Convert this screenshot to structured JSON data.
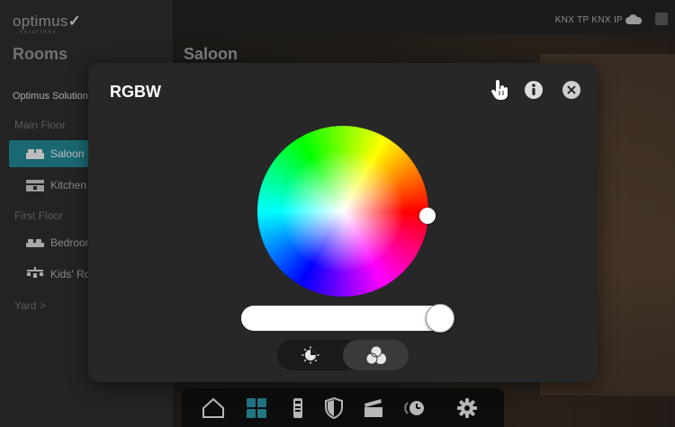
{
  "app": {
    "logo_text": "optimus",
    "logo_check": "✓",
    "logo_sub": "solutions"
  },
  "header": {
    "indicators": "KNX TP  KNX IP"
  },
  "sidebar": {
    "title": "Rooms",
    "building": "Optimus Solutions",
    "floors": [
      {
        "label": "Main Floor"
      },
      {
        "label": "First Floor"
      },
      {
        "label": "Yard  >"
      }
    ],
    "rooms": [
      {
        "label": "Saloon",
        "icon": "sofa-icon",
        "active": true
      },
      {
        "label": "Kitchen",
        "icon": "kitchen-icon",
        "active": false
      },
      {
        "label": "Bedroom",
        "icon": "bed-icon",
        "active": false
      },
      {
        "label": "Kids' Room",
        "icon": "kids-toy-icon",
        "active": false
      }
    ]
  },
  "main": {
    "room_title": "Saloon"
  },
  "modal": {
    "title": "RGBW",
    "buttons": {
      "touch": "touch-hand-icon",
      "info": "info-icon",
      "close": "close-icon"
    },
    "color": {
      "hue_deg": 357,
      "saturation": 0.99,
      "handle_color": "#ffffff"
    },
    "brightness": 0.98,
    "mode": {
      "options": [
        "white-temperature-icon",
        "rgb-circles-icon"
      ],
      "selected": "rgb"
    }
  },
  "dock": {
    "items": [
      {
        "icon": "home-icon",
        "active": false
      },
      {
        "icon": "grid-rooms-icon",
        "active": true
      },
      {
        "icon": "remote-icon",
        "active": false
      },
      {
        "icon": "shield-icon",
        "active": false
      },
      {
        "icon": "scenes-clapper-icon",
        "active": false
      },
      {
        "icon": "timer-icon",
        "active": false
      },
      {
        "icon": "settings-gear-icon",
        "active": false
      }
    ]
  },
  "colors": {
    "accent": "#1f7f8c",
    "modal_bg": "#272727",
    "dock_active": "#2a8fa0"
  }
}
